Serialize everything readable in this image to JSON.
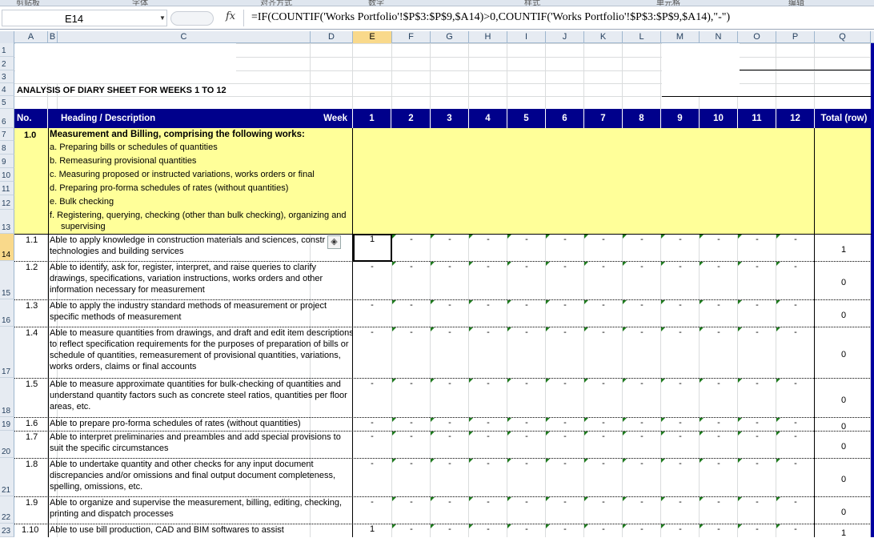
{
  "ribbon": {
    "fragments": [
      "剪贴板",
      "字体",
      "对齐方式",
      "数字",
      "样式",
      "单元格",
      "编辑"
    ]
  },
  "formula_bar": {
    "name_box": "E14",
    "fx_label": "fx",
    "formula": "=IF(COUNTIF('Works Portfolio'!$P$3:$P$9,$A14)>0,COUNTIF('Works Portfolio'!$P$3:$P$9,$A14),\"-\")"
  },
  "columns": [
    "A",
    "B",
    "C",
    "D",
    "E",
    "F",
    "G",
    "H",
    "I",
    "J",
    "K",
    "L",
    "M",
    "N",
    "O",
    "P",
    "Q"
  ],
  "active_column": "E",
  "row_numbers": [
    "1",
    "2",
    "3",
    "4",
    "5",
    "6",
    "7",
    "8",
    "9",
    "10",
    "11",
    "12",
    "13",
    "14",
    "15",
    "16",
    "17",
    "18",
    "19",
    "20",
    "21",
    "22",
    "23"
  ],
  "active_row": "14",
  "sheet": {
    "title": "ANALYSIS OF DIARY SHEET FOR WEEKS 1 TO 12",
    "header": {
      "no": "No.",
      "heading": "Heading / Description",
      "week": "Week",
      "weeks": [
        "1",
        "2",
        "3",
        "4",
        "5",
        "6",
        "7",
        "8",
        "9",
        "10",
        "11",
        "12"
      ],
      "total": "Total (row)"
    },
    "section": {
      "number": "1.0",
      "title": "Measurement and Billing, comprising the following works:",
      "items": [
        "a. Preparing bills or schedules of quantities",
        "b. Remeasuring provisional quantities",
        "c. Measuring proposed or instructed variations, works orders or final",
        "d. Preparing pro-forma schedules of rates (without quantities)",
        "e. Bulk checking",
        "f. Registering, querying, checking (other than bulk checking), organizing and",
        "supervising"
      ]
    },
    "rows": [
      {
        "no": "1.1",
        "lines": [
          "Able to apply knowledge in construction materials and sciences, constr",
          "technologies and building services"
        ],
        "wk1": "1",
        "total": "1"
      },
      {
        "no": "1.2",
        "lines": [
          "Able to identify, ask for, register, interpret, and raise queries to clarify",
          "drawings, specifications, variation instructions, works orders and other",
          "information necessary for measurement"
        ],
        "wk1": "-",
        "total": "0"
      },
      {
        "no": "1.3",
        "lines": [
          "Able to apply the industry standard methods of measurement or project",
          "specific methods of measurement"
        ],
        "wk1": "-",
        "total": "0"
      },
      {
        "no": "1.4",
        "lines": [
          "Able to measure quantities from drawings, and draft and edit item descriptions",
          "to reflect specification requirements for the purposes of preparation of bills or",
          "schedule of quantities, remeasurement of provisional quantities, variations,",
          "works orders, claims or final accounts"
        ],
        "wk1": "-",
        "total": "0"
      },
      {
        "no": "1.5",
        "lines": [
          "Able to measure approximate quantities for bulk-checking of quantities and",
          "understand quantity factors such as concrete steel ratios, quantities per floor",
          "areas, etc."
        ],
        "wk1": "-",
        "total": "0"
      },
      {
        "no": "1.6",
        "lines": [
          "Able to prepare pro-forma schedules of rates (without quantities)"
        ],
        "wk1": "-",
        "total": "0"
      },
      {
        "no": "1.7",
        "lines": [
          "Able to interpret preliminaries and preambles and add special provisions to",
          "suit the specific circumstances"
        ],
        "wk1": "-",
        "total": "0"
      },
      {
        "no": "1.8",
        "lines": [
          "Able to undertake quantity and other checks for any input document",
          "discrepancies and/or omissions and final output document completeness,",
          "spelling, omissions, etc."
        ],
        "wk1": "-",
        "total": "0"
      },
      {
        "no": "1.9",
        "lines": [
          "Able to organize and supervise the measurement, billing, editing, checking,",
          "printing and dispatch processes"
        ],
        "wk1": "-",
        "total": "0"
      },
      {
        "no": "1.10",
        "lines": [
          "Able to use bill production, CAD and BIM softwares to assist"
        ],
        "wk1": "1",
        "total": "1"
      }
    ],
    "other_week_value": "-"
  }
}
